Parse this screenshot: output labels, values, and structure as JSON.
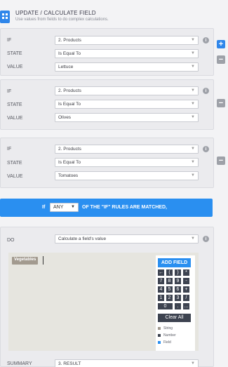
{
  "header": {
    "title": "UPDATE / CALCULATE FIELD",
    "subtitle": "Use values from fields to do complex calculations."
  },
  "labels": {
    "if": "IF",
    "state": "STATE",
    "value": "VALUE",
    "do": "DO",
    "summary": "SUMMARY"
  },
  "rules": [
    {
      "field": "2. Products",
      "state": "Is Equal To",
      "value": "Lettuce"
    },
    {
      "field": "2. Products",
      "state": "Is Equal To",
      "value": "Olives"
    },
    {
      "field": "2. Products",
      "state": "Is Equal To",
      "value": "Tomatoes"
    }
  ],
  "match_bar": {
    "prefix": "If",
    "quantifier": "ANY",
    "suffix": "OF THE \"IF\" RULES ARE MATCHED,"
  },
  "action": {
    "do_value": "Calculate a field's value",
    "summary_value": "3. RESULT"
  },
  "calculator": {
    "field_tag": "Vegetables",
    "add_field": "ADD FIELD",
    "keys": [
      [
        "←",
        "(",
        ")",
        "*"
      ],
      [
        "7",
        "8",
        "9",
        "-"
      ],
      [
        "4",
        "5",
        "6",
        "+"
      ],
      [
        "1",
        "2",
        "3",
        "/"
      ],
      [
        "0",
        ".",
        "..."
      ]
    ],
    "clear_all": "Clear All",
    "legend": [
      {
        "label": "String",
        "color": "#a29a8f"
      },
      {
        "label": "Number",
        "color": "#3d4350"
      },
      {
        "label": "Field",
        "color": "#2a8ff0"
      }
    ]
  },
  "icons": {
    "info": "info-icon",
    "add": "plus-icon",
    "remove": "minus-icon",
    "caret": "chevron-down-icon",
    "header": "calculator-icon"
  }
}
